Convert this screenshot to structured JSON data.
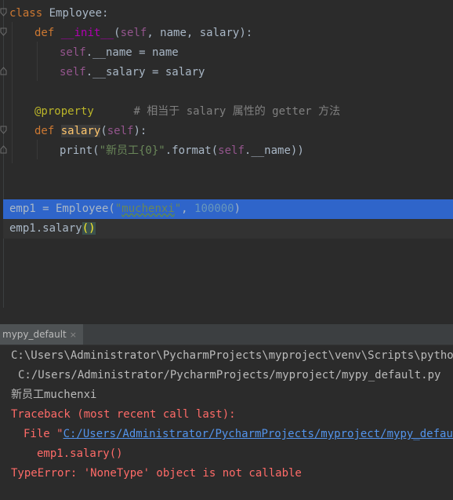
{
  "editor": {
    "lines": {
      "l1_kw": "class",
      "l1_name": "Employee:",
      "l2_kw": "def",
      "l2_fn": "__init__",
      "l2_open": "(",
      "l2_self": "self",
      "l2_rest": ", name, salary):",
      "l3_self": "self",
      "l3_rest": ".__name = name",
      "l4_self": "self",
      "l4_rest": ".__salary = salary",
      "l6_deco": "@property",
      "l6_comment": "# 相当于 salary 属性的 getter 方法",
      "l7_kw": "def",
      "l7_fn": "salary",
      "l7_open": "(",
      "l7_self": "self",
      "l7_close": "):",
      "l8_print": "print(",
      "l8_str": "\"新员工{0}\"",
      "l8_mid": ".format(",
      "l8_self": "self",
      "l8_rest": ".__name))",
      "l11_a": "emp1 = Employee(",
      "l11_q1": "\"",
      "l11_str": "muchenxi",
      "l11_q2": "\"",
      "l11_comma": ", ",
      "l11_num": "100000",
      "l11_close": ")",
      "l12_a": "emp1.salary",
      "l12_paren": "()"
    }
  },
  "run_panel": {
    "tab_label": "mypy_default",
    "tab_close": "×",
    "output": {
      "cmd_line1": "C:\\Users\\Administrator\\PycharmProjects\\myproject\\venv\\Scripts\\python.exe",
      "cmd_line2": "C:/Users/Administrator/PycharmProjects/myproject/mypy_default.py",
      "stdout": "新员工muchenxi",
      "traceback_header": "Traceback (most recent call last):",
      "file_prefix": "File \"",
      "file_link": "C:/Users/Administrator/PycharmProjects/myproject/mypy_default.py",
      "code_line": "emp1.salary()",
      "error": "TypeError: 'NoneType' object is not callable"
    }
  },
  "colors": {
    "editor_bg": "#2b2b2b",
    "selection": "#2f65ca",
    "keyword": "#cc7832",
    "error_text": "#ff6b68",
    "link": "#5394ec"
  }
}
